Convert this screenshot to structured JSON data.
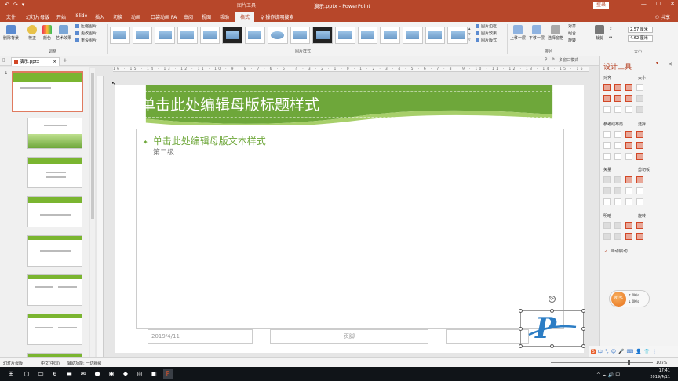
{
  "window": {
    "title": "演示.pptx - PowerPoint",
    "context_tool": "图片工具",
    "login": "登录",
    "share": "共享",
    "quick_access": [
      "↶",
      "↷",
      "▾"
    ],
    "controls": [
      "—",
      "☐",
      "✕"
    ]
  },
  "tabs": [
    "文件",
    "幻灯片母版",
    "开始",
    "iSlide",
    "插入",
    "切换",
    "动画",
    "口袋动画 PA",
    "审阅",
    "视图",
    "帮助",
    "格式"
  ],
  "active_tab": "格式",
  "tell_me": "操作说明搜索",
  "ribbon": {
    "remove_bg": "删除背景",
    "corrections": "校正",
    "color": "颜色",
    "artistic": "艺术效果",
    "compress": "压缩图片",
    "change": "更改图片",
    "reset": "重设图片",
    "adjust_group": "调整",
    "styles_group": "图片样式",
    "border": "图片边框",
    "effects": "图片效果",
    "layout": "图片版式",
    "bring_forward": "上移一层",
    "send_backward": "下移一层",
    "selection_pane": "选择窗格",
    "align": "对齐",
    "group": "组合",
    "rotate": "旋转",
    "arrange_group": "排列",
    "crop": "裁剪",
    "height": "2.57 厘米",
    "width": "4.62 厘米",
    "size_group": "大小"
  },
  "doc_tab": {
    "name": "演示.pptx",
    "close": "×",
    "add": "+",
    "multi_window": "多窗口模式"
  },
  "ruler_text": "16 · 15 · 14 · 13 · 12 · 11 · 10 · 9 · 8 · 7 · 6 · 5 · 4 · 3 · 2 · 1 · 0 · 1 · 2 · 3 · 4 · 5 · 6 · 7 · 8 · 9 · 10 · 11 · 12 · 13 · 14 · 15 · 16",
  "thumbnails": {
    "selected_number": "1"
  },
  "slide": {
    "title": "单击此处编辑母版标题样式",
    "body_level1": "单击此处编辑母版文本样式",
    "bullet": "✦",
    "body_level2": "第二级",
    "footer_date": "2019/4/11",
    "footer_center": "页脚",
    "logo_letter": "P"
  },
  "designer": {
    "title": "设计工具",
    "sections": [
      "对齐",
      "大小",
      "参考线布局",
      "选择",
      "矢量",
      "剪切板",
      "明暗",
      "旋转"
    ],
    "autorun": "自动启动",
    "check": "✓"
  },
  "widget": {
    "percent": "81%",
    "up": "0K/s",
    "down": "0K/s"
  },
  "ime": [
    "S",
    "中",
    "°,",
    "☺",
    "🎤",
    "⌨",
    "👤",
    "👕",
    "⋮"
  ],
  "status": {
    "slide_label": "幻灯片母版",
    "language": "中文(中国)",
    "accessibility": "辅助功能: 一切就绪",
    "zoom": "105%"
  },
  "taskbar": {
    "time": "17:41",
    "date": "2019/4/11",
    "tray": "^ ☁ 🔊 中"
  },
  "colors": {
    "accent": "#b7472a",
    "slide_green": "#6ea73a",
    "logo_blue": "#2c7dc4"
  }
}
